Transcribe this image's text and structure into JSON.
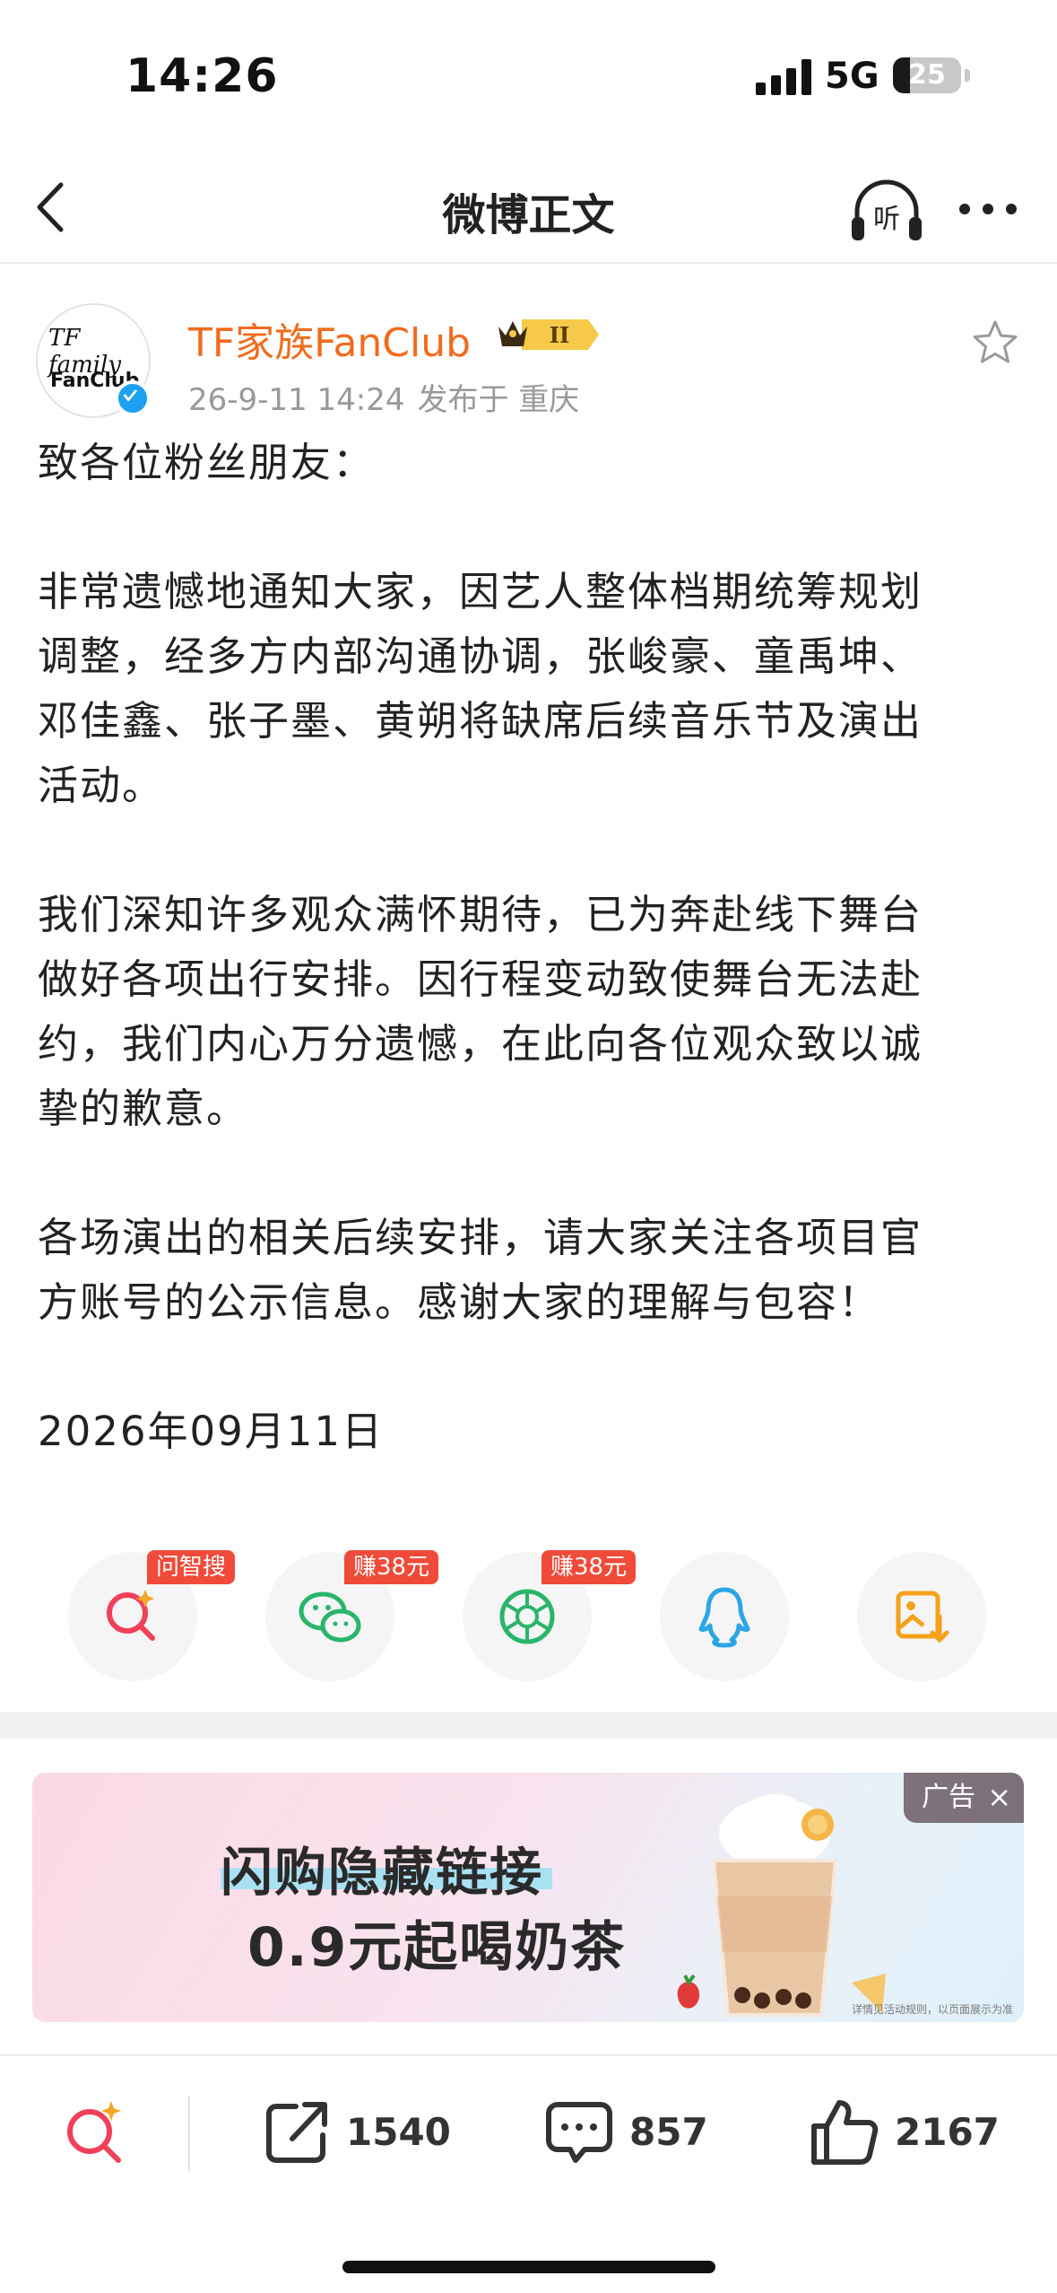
{
  "status_bar": {
    "time": "14:26",
    "network": "5G",
    "battery": "25",
    "battery_level": 0.25
  },
  "nav": {
    "title": "微博正文",
    "listen_label": "听"
  },
  "post": {
    "author": "TF家族FanClub",
    "avatar_text_1": "TF family",
    "avatar_text_2": "FanClub",
    "date": "26-9-11 14:24",
    "location": "发布于 重庆",
    "body": {
      "p1": "致各位粉丝朋友：",
      "p2_l1": "非常遗憾地通知大家，因艺人整体档期统筹规划",
      "p2_l2": "调整，经多方内部沟通协调，张峻豪、童禹坤、",
      "p2_l3": "邓佳鑫、张子墨、黄朔将缺席后续音乐节及演出",
      "p2_l4": "活动。",
      "p3_l1": "我们深知许多观众满怀期待，已为奔赴线下舞台",
      "p3_l2": "做好各项出行安排。因行程变动致使舞台无法赴",
      "p3_l3": "约，我们内心万分遗憾，在此向各位观众致以诚",
      "p3_l4": "挚的歉意。",
      "p4_l1": "各场演出的相关后续安排，请大家关注各项目官",
      "p4_l2": "方账号的公示信息。感谢大家的理解与包容！",
      "p5": "2026年09月11日"
    }
  },
  "share": {
    "tag_search": "问智搜",
    "tag_wechat": "赚38元",
    "tag_moments": "赚38元"
  },
  "ad": {
    "line1": "闪购隐藏链接",
    "line2": "0.9元起喝奶茶",
    "tag": "广告",
    "close": "×",
    "fine_print": "详情见活动规则，以页面展示为准"
  },
  "bottom_bar": {
    "reposts": "1540",
    "comments": "857",
    "likes": "2167"
  },
  "colors": {
    "author": "#f26b1d",
    "accent_red": "#f04a3a",
    "wechat_green": "#29b56b",
    "qq_blue": "#2aa6e6",
    "save_orange": "#f4a21a"
  }
}
